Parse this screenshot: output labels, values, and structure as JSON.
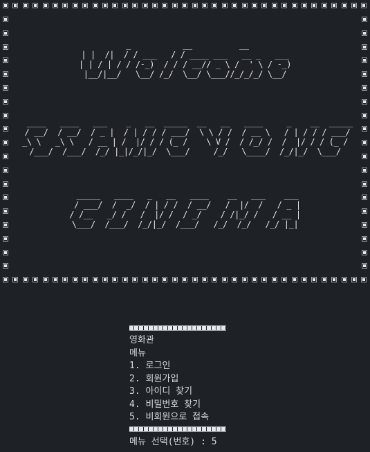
{
  "banner": {
    "line1": " _           __          __\n| |  /|  / / ___   / / ____ ___   __ _   ___\n| | / | / / /-_)  / / / __// _ \\ /  ' \\ / -_)\n|__/|__/   \\__/ /_/  \\__/ \\___//_/_/_/ \\__/",
    "line2": "  ____   ____   ___    _   __  _____  __   __   ____     _    __  _____\n / __/  / __/  / _ |  / | / / / ___/  \\ \\ / /  / __ \\   / | / / / ___/\n_\\ \\   _\\ \\   / __ | /  |/ / / (_ /    \\ V /  / /_/ /  /  |/ / / (_ /\n/___/  /___/  /_/ |_|/_/|_/  \\___/     /_/   \\____/  /_/|_/  \\___/",
    "line3": " _____   ____   _   __   ____    __   ___    ___\n / ___/  /  _/  / | / /  / __/   /  |/  /   / _ |\n/ /__   _/ /   /  |/ /  / _/    / /|_/ /   / __ |\n\\___/  /___/  /_/|_/  /___/   /_/  /_/   /_/ |_|"
  },
  "menu": {
    "title": "영화관",
    "subtitle": "메뉴",
    "items": [
      "1. 로그인",
      "2. 회원가입",
      "3. 아이디 찾기",
      "4. 비밀번호 찾기",
      "5. 비회원으로 접속"
    ],
    "prompt": "메뉴 선택(번호) : 5"
  },
  "colors": {
    "background": "#1e2125",
    "text": "#d7dadf",
    "border_block": "#e6e8eb"
  }
}
